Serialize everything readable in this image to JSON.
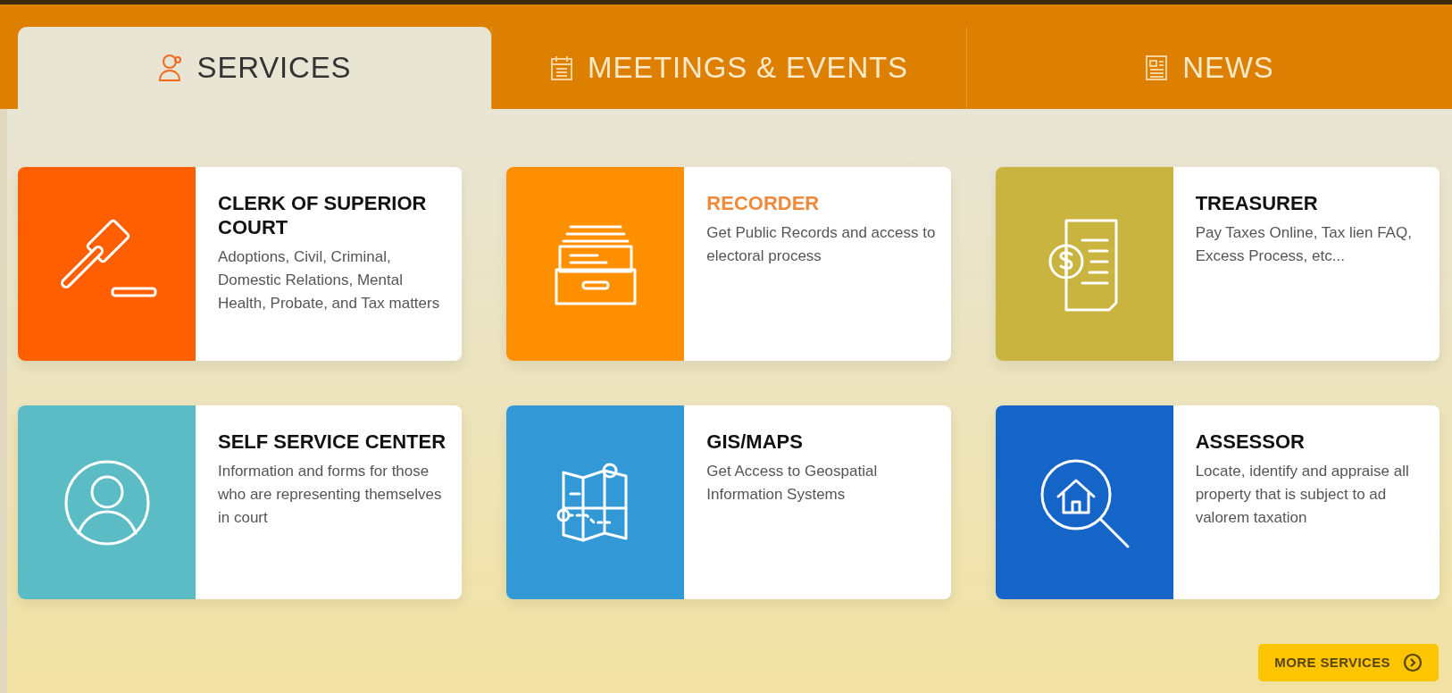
{
  "tabs": [
    {
      "label": "SERVICES",
      "selected": true
    },
    {
      "label": "MEETINGS & EVENTS",
      "selected": false
    },
    {
      "label": "NEWS",
      "selected": false
    }
  ],
  "cards": [
    {
      "title": "CLERK OF SUPERIOR COURT",
      "description": "Adoptions, Civil, Criminal, Domestic Relations, Mental Health, Probate, and Tax matters",
      "color": "#ff5f00",
      "highlighted": false
    },
    {
      "title": "RECORDER",
      "description": "Get Public Records and access to electoral process",
      "color": "#fe9000",
      "highlighted": true
    },
    {
      "title": "TREASURER",
      "description": "Pay Taxes Online, Tax lien FAQ, Excess Process, etc...",
      "color": "#c9b440",
      "highlighted": false
    },
    {
      "title": "SELF SERVICE CENTER",
      "description": "Information and forms for those who are representing themselves in court",
      "color": "#5bbcc6",
      "highlighted": false
    },
    {
      "title": "GIS/MAPS",
      "description": "Get Access to Geospatial Information Systems",
      "color": "#3399d6",
      "highlighted": false
    },
    {
      "title": "ASSESSOR",
      "description": "Locate, identify and appraise all property that is subject to ad valorem taxation",
      "color": "#1565c8",
      "highlighted": false
    }
  ],
  "more_button": {
    "label": "MORE SERVICES"
  }
}
